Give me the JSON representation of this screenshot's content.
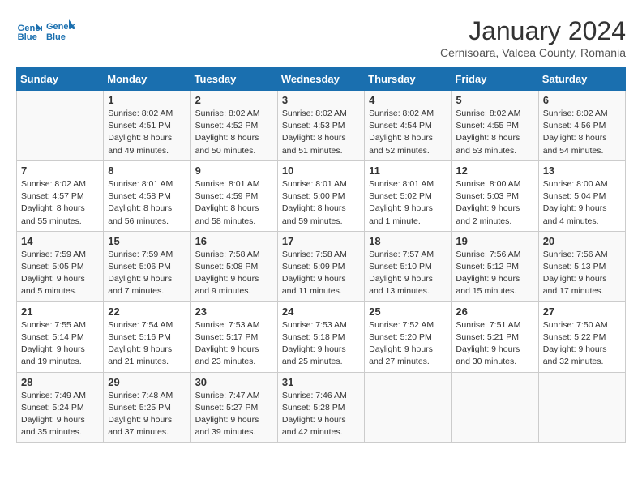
{
  "header": {
    "logo_line1": "General",
    "logo_line2": "Blue",
    "title": "January 2024",
    "location": "Cernisoara, Valcea County, Romania"
  },
  "days_of_week": [
    "Sunday",
    "Monday",
    "Tuesday",
    "Wednesday",
    "Thursday",
    "Friday",
    "Saturday"
  ],
  "weeks": [
    [
      {
        "day": "",
        "sunrise": "",
        "sunset": "",
        "daylight": ""
      },
      {
        "day": "1",
        "sunrise": "8:02 AM",
        "sunset": "4:51 PM",
        "daylight": "8 hours and 49 minutes."
      },
      {
        "day": "2",
        "sunrise": "8:02 AM",
        "sunset": "4:52 PM",
        "daylight": "8 hours and 50 minutes."
      },
      {
        "day": "3",
        "sunrise": "8:02 AM",
        "sunset": "4:53 PM",
        "daylight": "8 hours and 51 minutes."
      },
      {
        "day": "4",
        "sunrise": "8:02 AM",
        "sunset": "4:54 PM",
        "daylight": "8 hours and 52 minutes."
      },
      {
        "day": "5",
        "sunrise": "8:02 AM",
        "sunset": "4:55 PM",
        "daylight": "8 hours and 53 minutes."
      },
      {
        "day": "6",
        "sunrise": "8:02 AM",
        "sunset": "4:56 PM",
        "daylight": "8 hours and 54 minutes."
      }
    ],
    [
      {
        "day": "7",
        "sunrise": "8:02 AM",
        "sunset": "4:57 PM",
        "daylight": "8 hours and 55 minutes."
      },
      {
        "day": "8",
        "sunrise": "8:01 AM",
        "sunset": "4:58 PM",
        "daylight": "8 hours and 56 minutes."
      },
      {
        "day": "9",
        "sunrise": "8:01 AM",
        "sunset": "4:59 PM",
        "daylight": "8 hours and 58 minutes."
      },
      {
        "day": "10",
        "sunrise": "8:01 AM",
        "sunset": "5:00 PM",
        "daylight": "8 hours and 59 minutes."
      },
      {
        "day": "11",
        "sunrise": "8:01 AM",
        "sunset": "5:02 PM",
        "daylight": "9 hours and 1 minute."
      },
      {
        "day": "12",
        "sunrise": "8:00 AM",
        "sunset": "5:03 PM",
        "daylight": "9 hours and 2 minutes."
      },
      {
        "day": "13",
        "sunrise": "8:00 AM",
        "sunset": "5:04 PM",
        "daylight": "9 hours and 4 minutes."
      }
    ],
    [
      {
        "day": "14",
        "sunrise": "7:59 AM",
        "sunset": "5:05 PM",
        "daylight": "9 hours and 5 minutes."
      },
      {
        "day": "15",
        "sunrise": "7:59 AM",
        "sunset": "5:06 PM",
        "daylight": "9 hours and 7 minutes."
      },
      {
        "day": "16",
        "sunrise": "7:58 AM",
        "sunset": "5:08 PM",
        "daylight": "9 hours and 9 minutes."
      },
      {
        "day": "17",
        "sunrise": "7:58 AM",
        "sunset": "5:09 PM",
        "daylight": "9 hours and 11 minutes."
      },
      {
        "day": "18",
        "sunrise": "7:57 AM",
        "sunset": "5:10 PM",
        "daylight": "9 hours and 13 minutes."
      },
      {
        "day": "19",
        "sunrise": "7:56 AM",
        "sunset": "5:12 PM",
        "daylight": "9 hours and 15 minutes."
      },
      {
        "day": "20",
        "sunrise": "7:56 AM",
        "sunset": "5:13 PM",
        "daylight": "9 hours and 17 minutes."
      }
    ],
    [
      {
        "day": "21",
        "sunrise": "7:55 AM",
        "sunset": "5:14 PM",
        "daylight": "9 hours and 19 minutes."
      },
      {
        "day": "22",
        "sunrise": "7:54 AM",
        "sunset": "5:16 PM",
        "daylight": "9 hours and 21 minutes."
      },
      {
        "day": "23",
        "sunrise": "7:53 AM",
        "sunset": "5:17 PM",
        "daylight": "9 hours and 23 minutes."
      },
      {
        "day": "24",
        "sunrise": "7:53 AM",
        "sunset": "5:18 PM",
        "daylight": "9 hours and 25 minutes."
      },
      {
        "day": "25",
        "sunrise": "7:52 AM",
        "sunset": "5:20 PM",
        "daylight": "9 hours and 27 minutes."
      },
      {
        "day": "26",
        "sunrise": "7:51 AM",
        "sunset": "5:21 PM",
        "daylight": "9 hours and 30 minutes."
      },
      {
        "day": "27",
        "sunrise": "7:50 AM",
        "sunset": "5:22 PM",
        "daylight": "9 hours and 32 minutes."
      }
    ],
    [
      {
        "day": "28",
        "sunrise": "7:49 AM",
        "sunset": "5:24 PM",
        "daylight": "9 hours and 35 minutes."
      },
      {
        "day": "29",
        "sunrise": "7:48 AM",
        "sunset": "5:25 PM",
        "daylight": "9 hours and 37 minutes."
      },
      {
        "day": "30",
        "sunrise": "7:47 AM",
        "sunset": "5:27 PM",
        "daylight": "9 hours and 39 minutes."
      },
      {
        "day": "31",
        "sunrise": "7:46 AM",
        "sunset": "5:28 PM",
        "daylight": "9 hours and 42 minutes."
      },
      {
        "day": "",
        "sunrise": "",
        "sunset": "",
        "daylight": ""
      },
      {
        "day": "",
        "sunrise": "",
        "sunset": "",
        "daylight": ""
      },
      {
        "day": "",
        "sunrise": "",
        "sunset": "",
        "daylight": ""
      }
    ]
  ]
}
